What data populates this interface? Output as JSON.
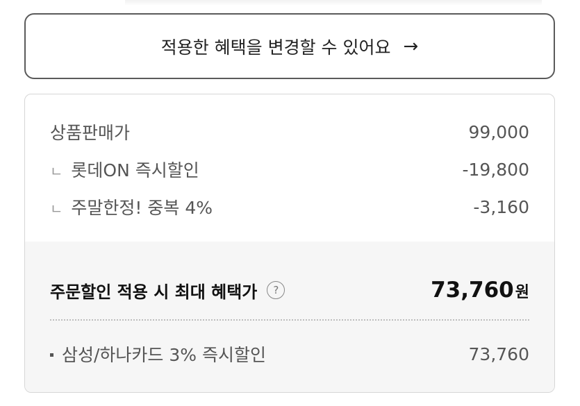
{
  "benefit_button": {
    "label": "적용한 혜택을 변경할 수 있어요",
    "arrow": "→"
  },
  "price_summary": {
    "items": [
      {
        "label": "상품판매가",
        "value": "99,000"
      },
      {
        "prefix": "ㄴ",
        "label": "롯데ON 즉시할인",
        "value": "-19,800"
      },
      {
        "prefix": "ㄴ",
        "label": "주말한정! 중복 4%",
        "value": "-3,160"
      }
    ]
  },
  "max_benefit": {
    "label": "주문할인 적용 시 최대 혜택가",
    "help": "?",
    "value": "73,760",
    "unit": "원"
  },
  "card_discount": {
    "label": "삼성/하나카드 3% 즉시할인",
    "value": "73,760"
  }
}
